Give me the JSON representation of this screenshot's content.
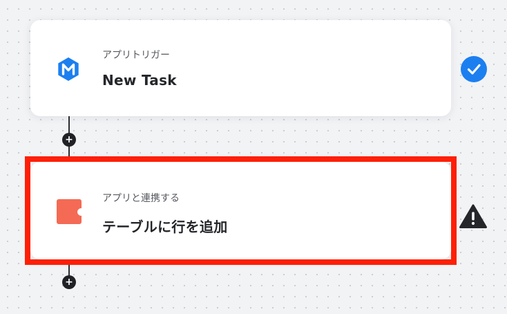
{
  "flow": {
    "steps": [
      {
        "subtitle": "アプリトリガー",
        "title": "New Task",
        "icon": "meistertask-logo-icon",
        "icon_color": "#1c7ff0",
        "status": "check-circle-icon",
        "status_color": "#1c7ff0"
      },
      {
        "subtitle": "アプリと連携する",
        "title": "テーブルに行を追加",
        "icon": "coda-logo-icon",
        "icon_color": "#f46a54",
        "status": "warning-triangle-icon",
        "status_color": "#24262a",
        "highlighted": true,
        "highlight_color": "#ff1f07"
      }
    ],
    "add_step_symbol": "+"
  }
}
